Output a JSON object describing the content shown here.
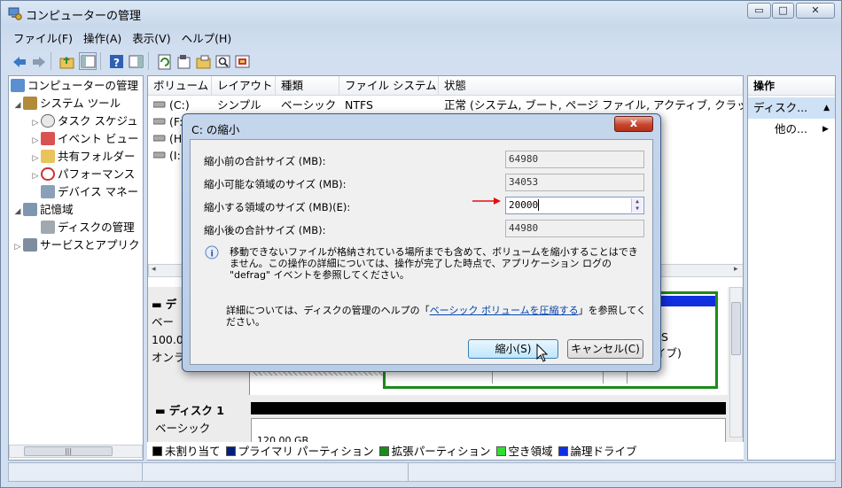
{
  "window": {
    "title": "コンピューターの管理",
    "btn_min": "▭",
    "btn_max": "□",
    "btn_close": "✕"
  },
  "menu": [
    "ファイル(F)",
    "操作(A)",
    "表示(V)",
    "ヘルプ(H)"
  ],
  "tree": {
    "root": "コンピューターの管理",
    "system_tools": "システム ツール",
    "task_scheduler": "タスク スケジュ",
    "event_viewer": "イベント ビュー",
    "shared_folders": "共有フォルダー",
    "performance": "パフォーマンス",
    "device_manager": "デバイス マネー",
    "storage": "記憶域",
    "disk_management": "ディスクの管理",
    "services": "サービスとアプリク"
  },
  "volumes": {
    "headers": [
      "ボリューム",
      "レイアウト",
      "種類",
      "ファイル システム",
      "状態"
    ],
    "rows": [
      {
        "vol": "(C:)",
        "layout": "シンプル",
        "type": "ベーシック",
        "fs": "NTFS",
        "status": "正常 (システム, ブート, ページ ファイル, アクティブ, クラッシ"
      },
      {
        "vol": "(F:"
      },
      {
        "vol": "(H"
      },
      {
        "vol": "(I:"
      }
    ]
  },
  "disk0": {
    "name": "デ",
    "type": "ベー",
    "size": "100.0",
    "state": "オンラ",
    "part_fs": "NTFS",
    "part_state": "ドライブ)"
  },
  "disk1": {
    "name": "ディスク 1",
    "type": "ベーシック",
    "size": "120.00 GB",
    "size2": "120.00 GB"
  },
  "legend": [
    "未割り当て",
    "プライマリ パーティション",
    "拡張パーティション",
    "空き領域",
    "論理ドライブ"
  ],
  "legend_colors": [
    "#000000",
    "#00207a",
    "#1c8a1c",
    "#33dd33",
    "#1030e0"
  ],
  "actions": {
    "header": "操作",
    "selected": "ディスク...",
    "more": "他の..."
  },
  "dialog": {
    "title": "C: の縮小",
    "close": "x",
    "fields": [
      {
        "label": "縮小前の合計サイズ (MB):",
        "value": "64980"
      },
      {
        "label": "縮小可能な領域のサイズ (MB):",
        "value": "34053"
      },
      {
        "label": "縮小する領域のサイズ (MB)(E):",
        "value": "20000"
      },
      {
        "label": "縮小後の合計サイズ (MB):",
        "value": "44980"
      }
    ],
    "info": "移動できないファイルが格納されている場所までも含めて、ボリュームを縮小することはできません。この操作の詳細については、操作が完了した時点で、アプリケーション ログの \"defrag\" イベントを参照してください。",
    "help_prefix": "詳細については、ディスクの管理のヘルプの「",
    "help_link": "ベーシック ボリュームを圧縮する",
    "help_suffix": "」を参照してください。",
    "ok": "縮小(S)",
    "cancel": "キャンセル(C)"
  }
}
